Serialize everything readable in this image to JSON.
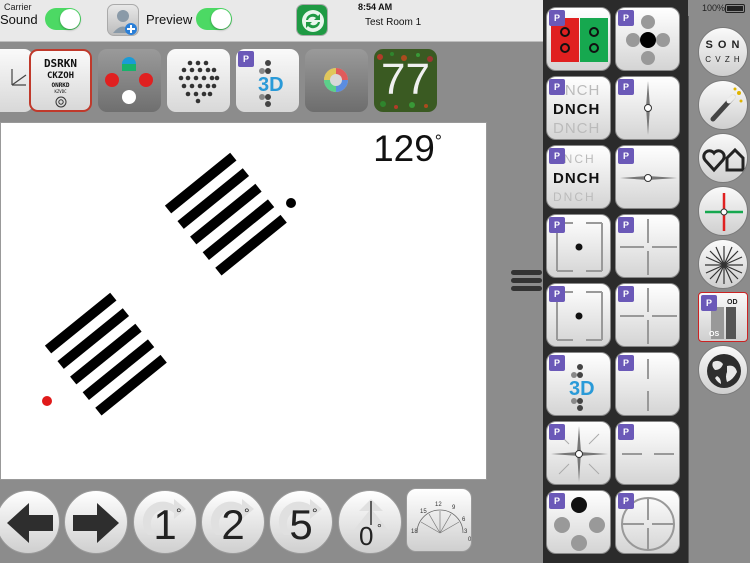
{
  "status": {
    "carrier": "Carrier",
    "time": "8:54 AM",
    "battery": "100%"
  },
  "header": {
    "sound_label": "Sound",
    "preview_label": "Preview",
    "room_name": "Test Room 1"
  },
  "chart_row": {
    "letters_line1": "DSRKN",
    "letters_line2": "CKZOH",
    "letters_line3": "ONRKD",
    "letters_line4": "KZVDC",
    "color_plate_number": "77"
  },
  "display": {
    "angle_value": "129",
    "angle_unit": "°"
  },
  "controls": {
    "step1": "1",
    "step2": "2",
    "step5": "5",
    "reset_value": "0",
    "degree": "°",
    "dial_labels": [
      "12",
      "9",
      "15",
      "6",
      "18",
      "3",
      "0"
    ]
  },
  "grid": {
    "badge": "P",
    "letter_row": "DNCH"
  },
  "categories": {
    "letters_top": "S O N",
    "letters_bottom": "C V Z H",
    "od": "OD",
    "os": "OS"
  },
  "colors": {
    "toggle_on": "#4cd964",
    "badge": "#6b59b8",
    "red_dot": "#e01a1a"
  }
}
